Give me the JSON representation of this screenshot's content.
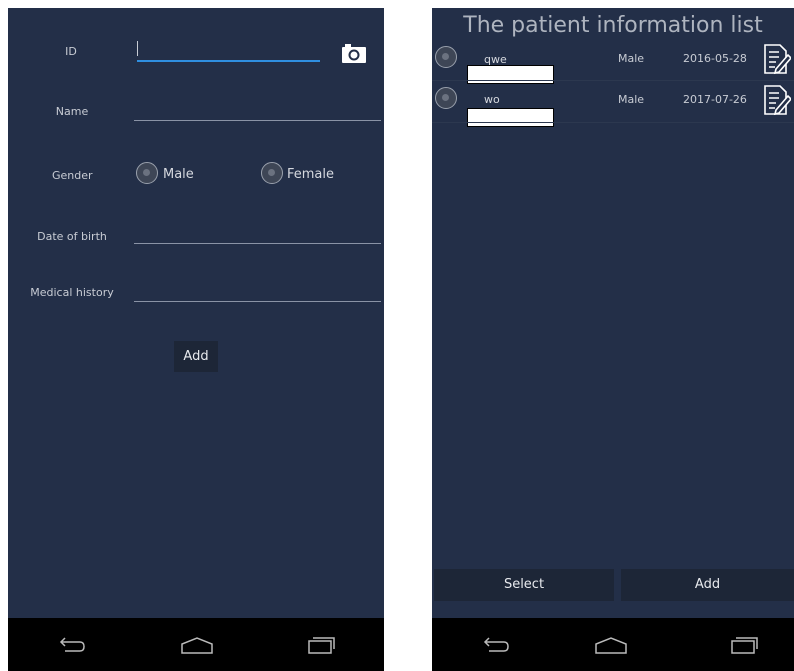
{
  "form": {
    "id_label": "ID",
    "name_label": "Name",
    "gender_label": "Gender",
    "gender_options": [
      "Male",
      "Female"
    ],
    "dob_label": "Date of birth",
    "history_label": "Medical history",
    "add_button": "Add",
    "camera_icon": "camera-icon"
  },
  "list": {
    "title": "The patient information list",
    "patients": [
      {
        "name": "qwe",
        "gender": "Male",
        "date": "2016-05-28"
      },
      {
        "name": "wo",
        "gender": "Male",
        "date": "2017-07-26"
      }
    ],
    "select_button": "Select",
    "add_button": "Add"
  },
  "navbar": {
    "icons": [
      "back-icon",
      "home-icon",
      "recents-icon"
    ]
  },
  "colors": {
    "background": "#232f48",
    "accent": "#2f8fe0"
  }
}
